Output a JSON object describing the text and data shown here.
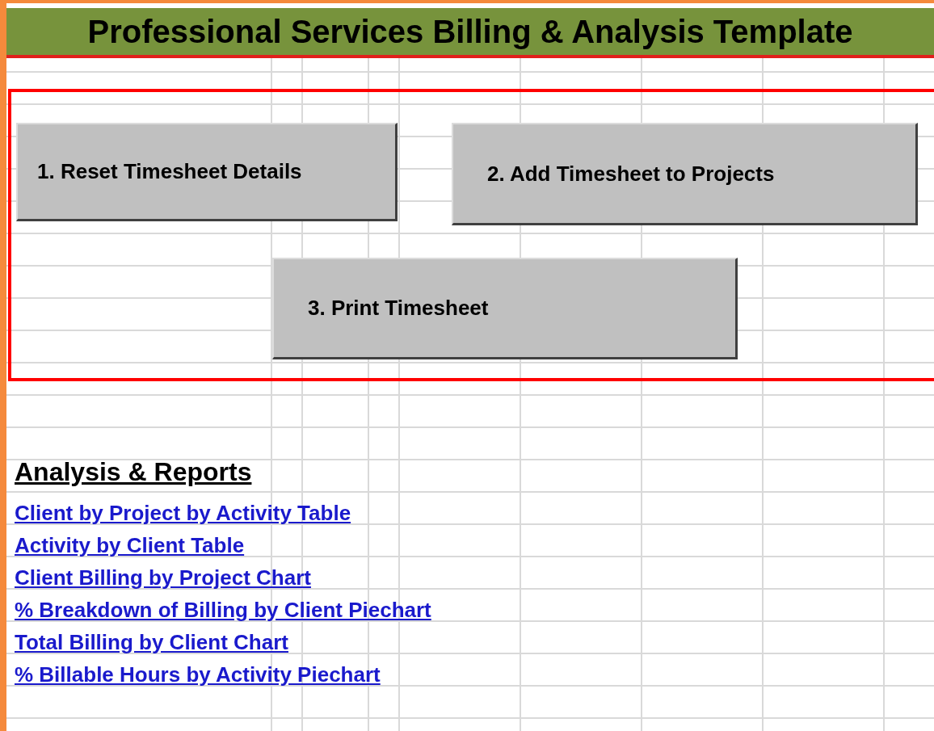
{
  "title": "Professional Services Billing & Analysis Template",
  "buttons": [
    {
      "label": "1. Reset Timesheet Details"
    },
    {
      "label": "2. Add Timesheet to Projects"
    },
    {
      "label": "3. Print Timesheet"
    }
  ],
  "reports": {
    "heading": "Analysis & Reports",
    "links": [
      "Client by Project by Activity Table",
      "Activity by Client Table",
      "Client Billing by Project Chart",
      "% Breakdown of Billing by Client Piechart",
      "Total Billing by Client Chart",
      "% Billable Hours by Activity Piechart"
    ]
  }
}
